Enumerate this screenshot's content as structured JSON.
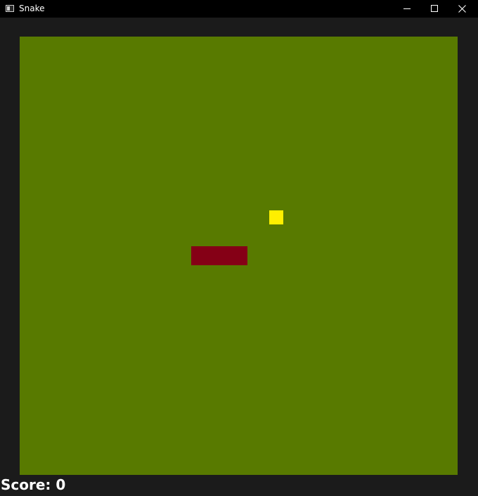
{
  "window": {
    "title": "Snake",
    "app_icon": "window-app-icon",
    "controls": {
      "minimize_icon": "minimize-icon",
      "maximize_icon": "maximize-icon",
      "close_icon": "close-icon"
    }
  },
  "game": {
    "colors": {
      "background": "#1b1b1b",
      "board": "#587a00",
      "snake": "#850016",
      "food": "#ffef00"
    },
    "score_label": "Score: 0"
  }
}
